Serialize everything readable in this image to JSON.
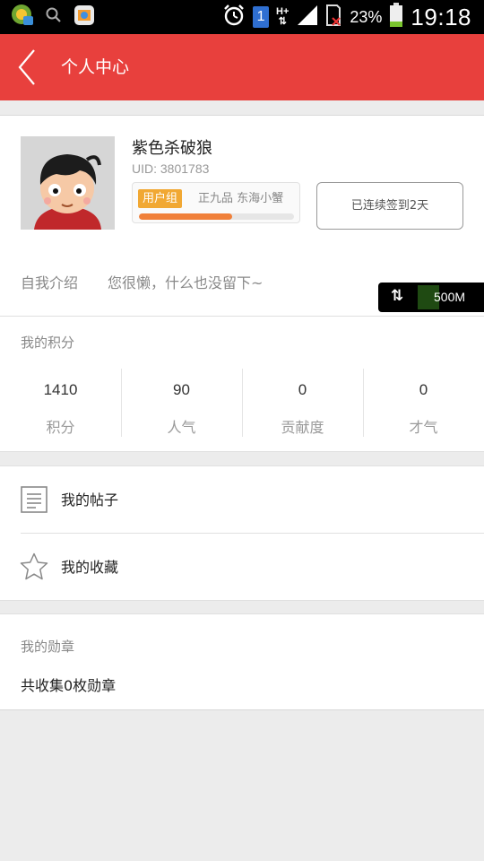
{
  "status_bar": {
    "time": "19:18",
    "battery_percent": "23%",
    "sim_badge": "1",
    "network": "H+",
    "icons": [
      "app-icon",
      "search-icon",
      "gallery-icon",
      "alarm-icon",
      "sim-badge-icon",
      "network-icon",
      "signal-icon",
      "sd-card-icon",
      "battery-icon"
    ]
  },
  "header": {
    "title": "个人中心",
    "back_icon": "chevron-left-icon"
  },
  "profile": {
    "username": "紫色杀破狼",
    "uid": "UID: 3801783",
    "group_label": "用户组",
    "group_rank": "正九品  东海小蟹",
    "level_progress": 0.6,
    "checkin_label": "已连续签到2天"
  },
  "intro": {
    "label": "自我介绍",
    "text": "您很懒，什么也没留下~"
  },
  "floating_widget": {
    "value": "500M"
  },
  "points": {
    "title": "我的积分",
    "stats": [
      {
        "value": "1410",
        "label": "积分"
      },
      {
        "value": "90",
        "label": "人气"
      },
      {
        "value": "0",
        "label": "贡献度"
      },
      {
        "value": "0",
        "label": "才气"
      }
    ]
  },
  "menu": {
    "items": [
      {
        "label": "我的帖子",
        "icon": "document-icon"
      },
      {
        "label": "我的收藏",
        "icon": "star-icon"
      }
    ]
  },
  "medals": {
    "title": "我的勋章",
    "count_text": "共收集0枚勋章"
  },
  "colors": {
    "header_bg": "#e8403d",
    "group_badge": "#f1a833",
    "progress": "#f0803a",
    "background": "#ececec"
  }
}
